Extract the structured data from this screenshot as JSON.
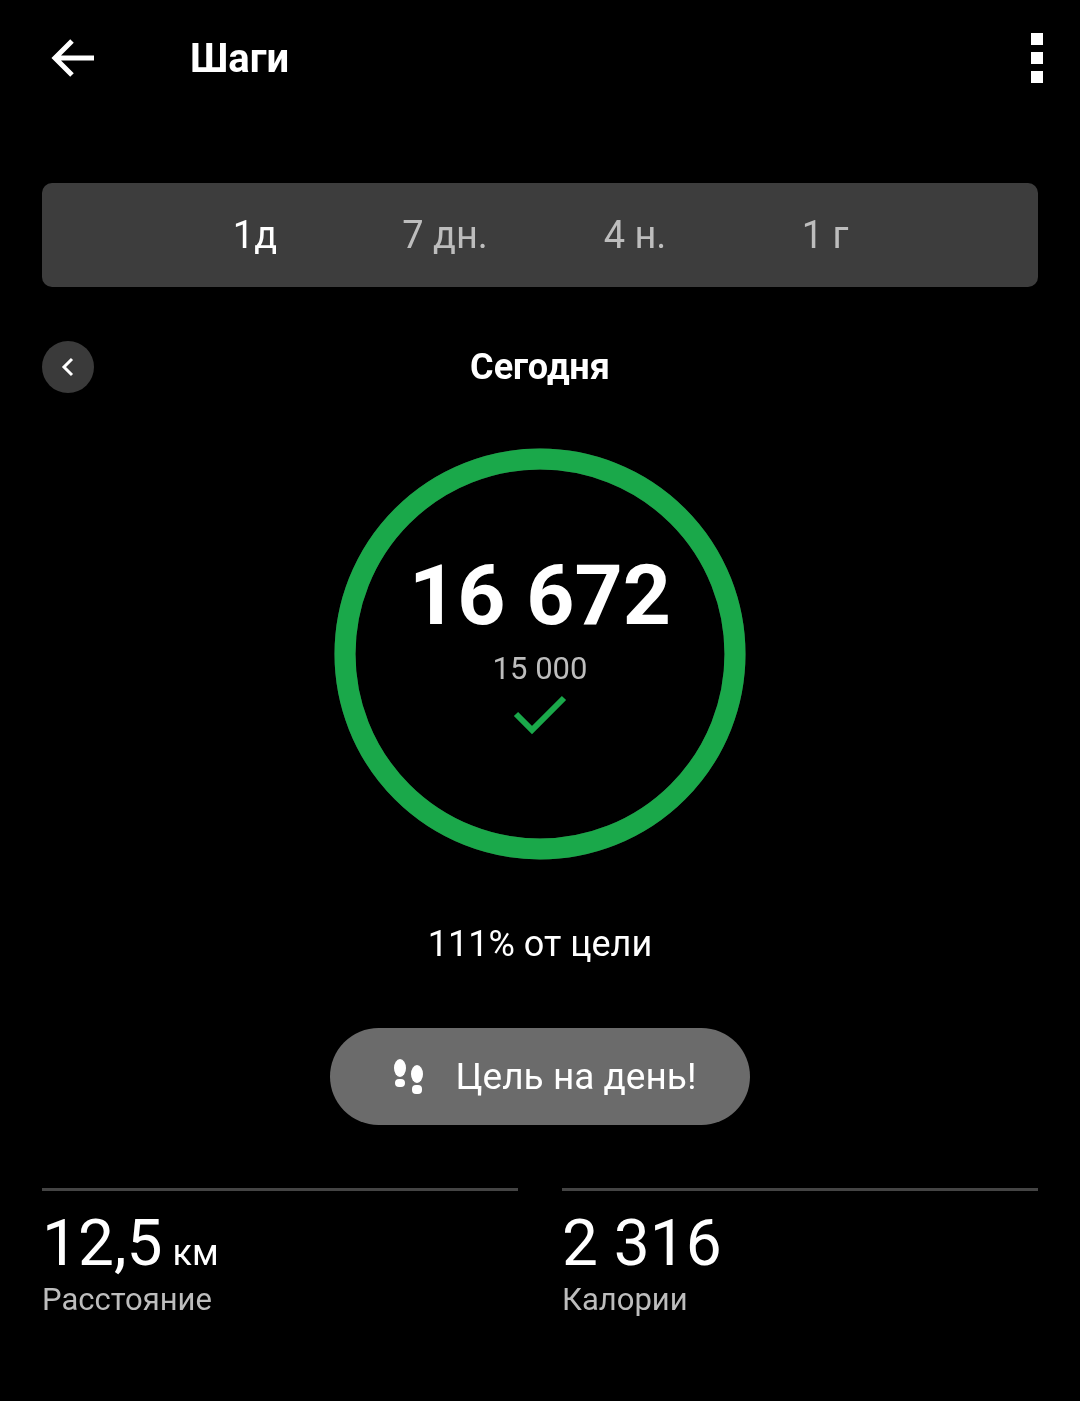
{
  "header": {
    "title": "Шаги"
  },
  "tabs": [
    {
      "label": "1д",
      "selected": true
    },
    {
      "label": "7 дн.",
      "selected": false
    },
    {
      "label": "4 н.",
      "selected": false
    },
    {
      "label": "1 г",
      "selected": false
    }
  ],
  "day": {
    "label": "Сегодня"
  },
  "ring": {
    "steps": "16 672",
    "goal": "15 000",
    "level": 1,
    "goal_met": true
  },
  "percent": "111% от цели",
  "goal_button": {
    "label": "Цель на день!"
  },
  "stats": [
    {
      "value": "12,5",
      "unit": "км",
      "label": "Расстояние"
    },
    {
      "value": "2 316",
      "label": "Калории"
    }
  ]
}
